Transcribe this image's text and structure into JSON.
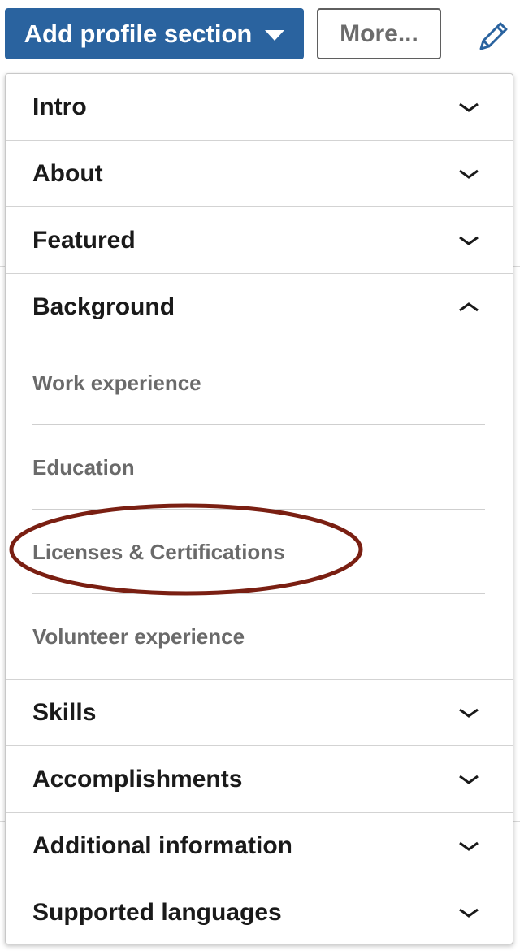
{
  "toolbar": {
    "add_section_label": "Add profile section",
    "more_label": "More...",
    "edit_icon": "pencil-icon"
  },
  "dropdown": {
    "sections": [
      {
        "label": "Intro",
        "state": "collapsed"
      },
      {
        "label": "About",
        "state": "collapsed"
      },
      {
        "label": "Featured",
        "state": "collapsed"
      },
      {
        "label": "Background",
        "state": "expanded"
      },
      {
        "label": "Skills",
        "state": "collapsed"
      },
      {
        "label": "Accomplishments",
        "state": "collapsed"
      },
      {
        "label": "Additional information",
        "state": "collapsed"
      },
      {
        "label": "Supported languages",
        "state": "collapsed"
      }
    ],
    "background_items": [
      {
        "label": "Work experience"
      },
      {
        "label": "Education"
      },
      {
        "label": "Licenses & Certifications",
        "highlighted": true
      },
      {
        "label": "Volunteer experience"
      }
    ]
  },
  "colors": {
    "primary_button": "#2a639f",
    "highlight_oval": "#7a1f12"
  }
}
